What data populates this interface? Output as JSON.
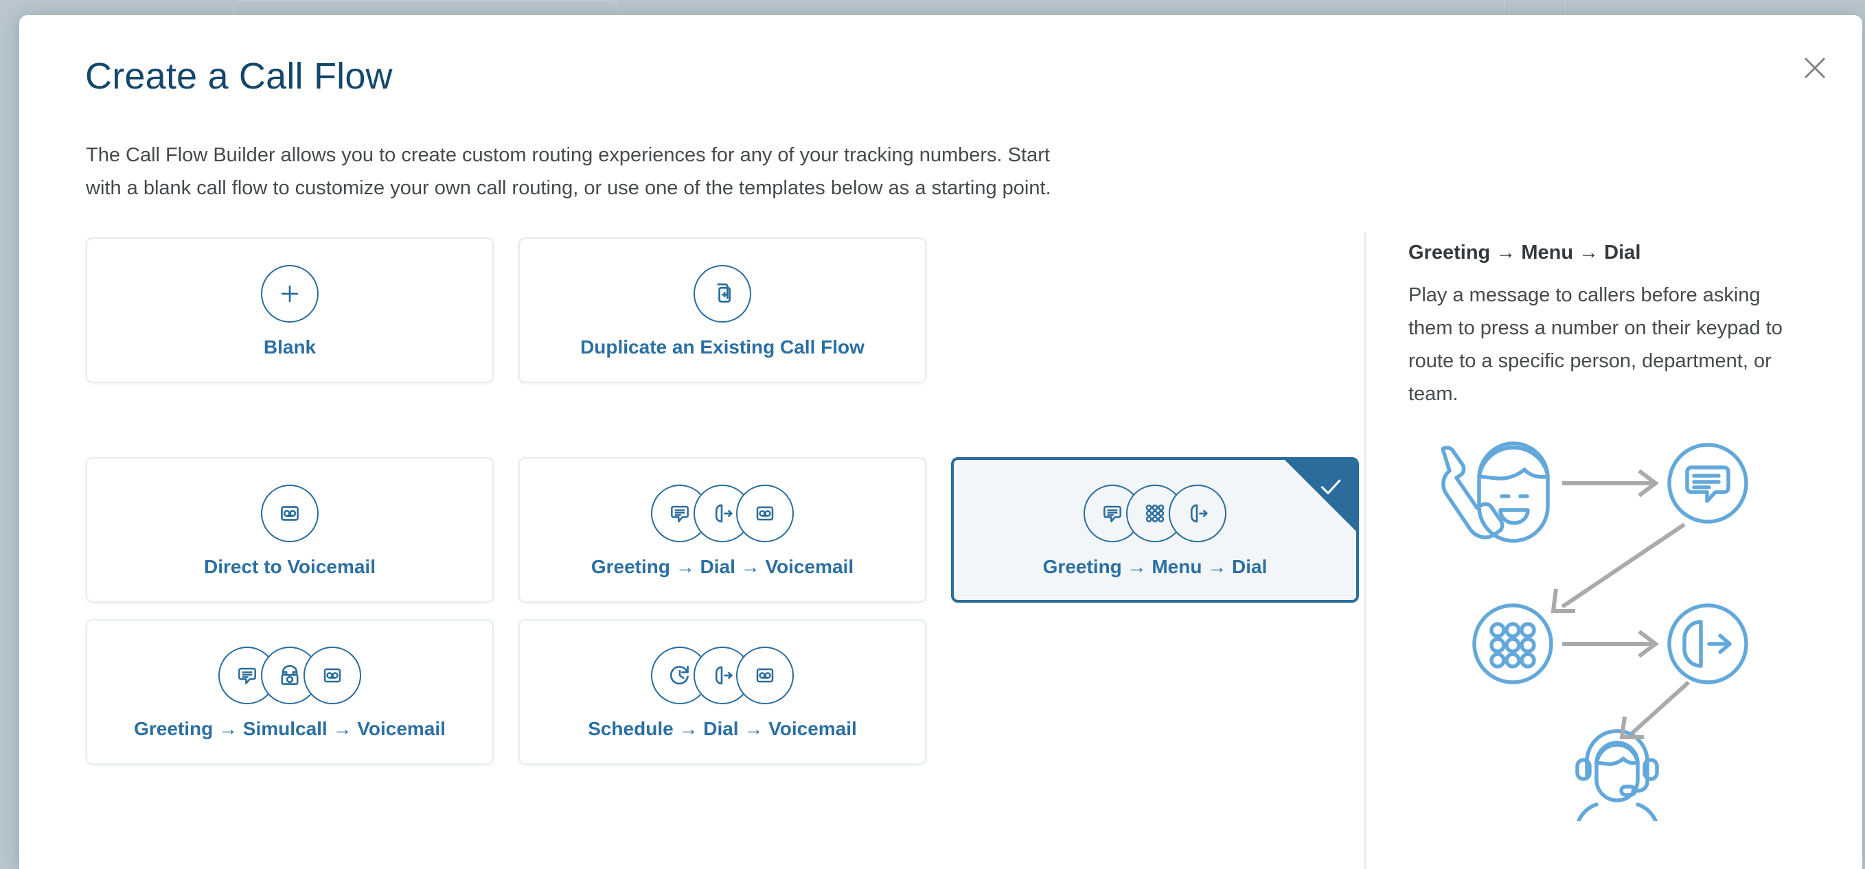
{
  "modal": {
    "title": "Create a Call Flow",
    "description": "The Call Flow Builder allows you to create custom routing experiences for any of your tracking numbers. Start with a blank call flow to customize your own call routing, or use one of the templates below as a starting point.",
    "close_label": "Close"
  },
  "cards": {
    "row_top": [
      {
        "id": "blank",
        "label": "Blank",
        "icons": [
          "plus-icon"
        ],
        "selected": false
      },
      {
        "id": "duplicate",
        "label": "Duplicate an Existing Call Flow",
        "icons": [
          "duplicate-icon"
        ],
        "selected": false
      }
    ],
    "row_mid": [
      {
        "id": "direct-to-voicemail",
        "label": "Direct to Voicemail",
        "icons": [
          "voicemail-icon"
        ],
        "selected": false
      },
      {
        "id": "greeting-dial-voicemail",
        "label": "Greeting → Dial → Voicemail",
        "icons": [
          "greeting-icon",
          "dial-icon",
          "voicemail-icon"
        ],
        "selected": false
      },
      {
        "id": "greeting-menu-dial",
        "label": "Greeting → Menu → Dial",
        "icons": [
          "greeting-icon",
          "keypad-icon",
          "dial-icon"
        ],
        "selected": true
      }
    ],
    "row_bottom": [
      {
        "id": "greeting-simulcall-voicemail",
        "label": "Greeting → Simulcall → Voicemail",
        "icons": [
          "greeting-icon",
          "deskphone-icon",
          "voicemail-icon"
        ],
        "selected": false
      },
      {
        "id": "schedule-dial-voicemail",
        "label": "Schedule → Dial → Voicemail",
        "icons": [
          "clock-icon",
          "dial-icon",
          "voicemail-icon"
        ],
        "selected": false
      }
    ]
  },
  "preview": {
    "title": "Greeting → Menu → Dial",
    "description": "Play a message to callers before asking them to press a number on their keypad to route to a specific person, department, or team.",
    "illustration_nodes": [
      "caller-icon",
      "greeting-bubble-icon",
      "keypad-icon",
      "outbound-call-icon",
      "agent-headset-icon"
    ]
  },
  "colors": {
    "brand_blue": "#2b6fa3",
    "title_navy": "#13476b",
    "selected_border": "#2a6c9c",
    "selected_fill": "#f2f6f8",
    "card_border": "#e4edf1",
    "body_text": "#444a4d",
    "illustration_blue": "#63a8db",
    "arrow_gray": "#a8aaac",
    "backdrop": "#b9c6ce"
  }
}
